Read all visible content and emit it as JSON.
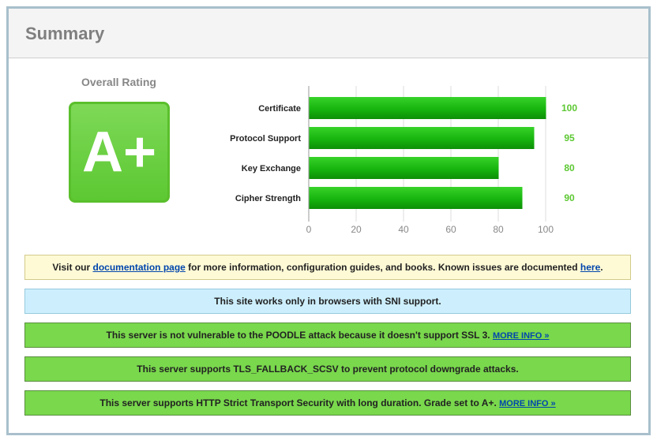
{
  "header": {
    "title": "Summary"
  },
  "rating": {
    "label": "Overall Rating",
    "grade": "A+"
  },
  "chart_data": {
    "type": "bar",
    "orientation": "horizontal",
    "categories": [
      "Certificate",
      "Protocol Support",
      "Key Exchange",
      "Cipher Strength"
    ],
    "values": [
      100,
      95,
      80,
      90
    ],
    "xlim": [
      0,
      100
    ],
    "xticks": [
      0,
      20,
      40,
      60,
      80,
      100
    ],
    "bar_color": "#22b31a",
    "value_label_color": "#5cc832",
    "grid": true
  },
  "notices": [
    {
      "type": "yellow",
      "parts": [
        {
          "text": "Visit our ",
          "link": false
        },
        {
          "text": "documentation page",
          "link": true
        },
        {
          "text": " for more information, configuration guides, and books. Known issues are documented ",
          "link": false
        },
        {
          "text": "here",
          "link": true
        },
        {
          "text": ".",
          "link": false
        }
      ]
    },
    {
      "type": "blue",
      "parts": [
        {
          "text": "This site works only in browsers with SNI support.",
          "link": false
        }
      ]
    },
    {
      "type": "green",
      "parts": [
        {
          "text": "This server is not vulnerable to the POODLE attack because it doesn't support SSL 3. ",
          "link": false
        },
        {
          "text": "MORE INFO »",
          "link": true,
          "small": true
        }
      ]
    },
    {
      "type": "green",
      "parts": [
        {
          "text": "This server supports TLS_FALLBACK_SCSV to prevent protocol downgrade attacks.",
          "link": false
        }
      ]
    },
    {
      "type": "green",
      "parts": [
        {
          "text": "This server supports HTTP Strict Transport Security with long duration. Grade set to A+. ",
          "link": false
        },
        {
          "text": "MORE INFO »",
          "link": true,
          "small": true
        }
      ]
    }
  ]
}
